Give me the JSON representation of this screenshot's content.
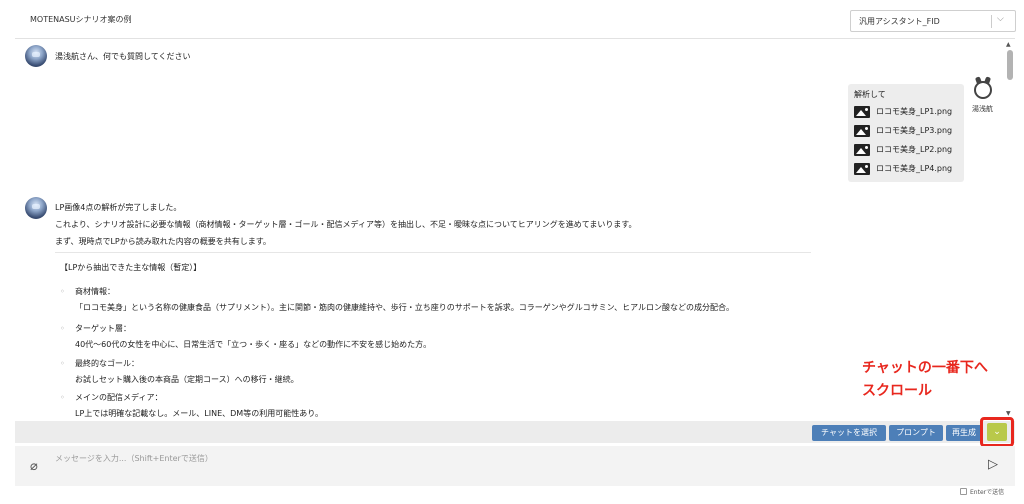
{
  "header": {
    "title": "MOTENASUシナリオ案の例",
    "assistant_select": "汎用アシスタント_FID"
  },
  "greeting": "湯浅航さん、何でも質問してください",
  "user_message": {
    "user_name": "湯浅航",
    "request": "解析して",
    "files": [
      "ロコモ美身_LP1.png",
      "ロコモ美身_LP3.png",
      "ロコモ美身_LP2.png",
      "ロコモ美身_LP4.png"
    ]
  },
  "bot_response": {
    "line1": "LP画像4点の解析が完了しました。",
    "line2": "これより、シナリオ設計に必要な情報（商材情報・ターゲット層・ゴール・配信メディア等）を抽出し、不足・曖昧な点についてヒアリングを進めてまいります。",
    "line3": "まず、現時点でLPから読み取れた内容の概要を共有します。",
    "section_title": "【LPから抽出できた主な情報（暫定）】",
    "items": [
      {
        "label": "商材情報：",
        "detail": "「ロコモ美身」という名称の健康食品（サプリメント）。主に関節・筋肉の健康維持や、歩行・立ち座りのサポートを訴求。コラーゲンやグルコサミン、ヒアルロン酸などの成分配合。"
      },
      {
        "label": "ターゲット層：",
        "detail": "40代〜60代の女性を中心に、日常生活で「立つ・歩く・座る」などの動作に不安を感じ始めた方。"
      },
      {
        "label": "最終的なゴール：",
        "detail": "お試しセット購入後の本商品（定期コース）への移行・継続。"
      },
      {
        "label": "メインの配信メディア：",
        "detail": "LP上では明確な記載なし。メール、LINE、DM等の利用可能性あり。"
      }
    ]
  },
  "annotation": {
    "line1": "チャットの一番下へ",
    "line2": "スクロール"
  },
  "toolbar": {
    "select_chat": "チャットを選択",
    "prompt": "プロンプト",
    "regenerate": "再生成"
  },
  "input": {
    "placeholder": "メッセージを入力...（Shift+Enterで送信）",
    "enter_send_label": "Enterで送信"
  },
  "colors": {
    "button_blue": "#4d7fb8",
    "scroll_button": "#b9c94a",
    "annotation_red": "#e8271e"
  }
}
